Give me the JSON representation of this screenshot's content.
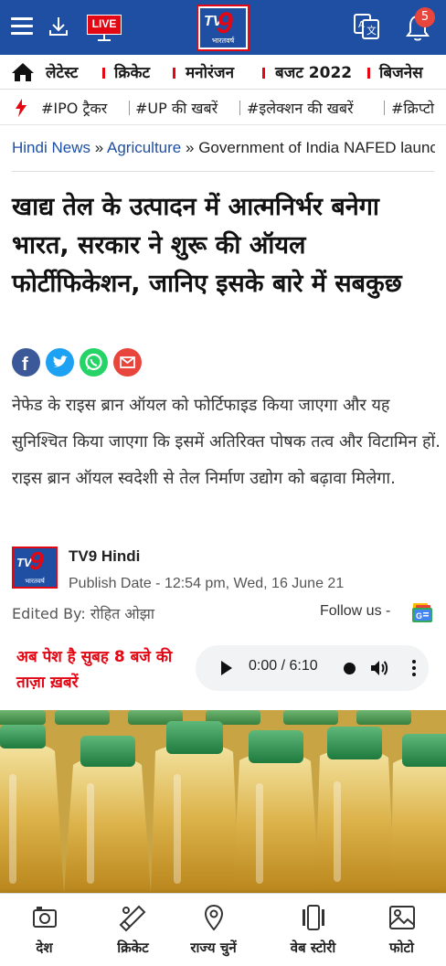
{
  "header": {
    "live_label": "LIVE",
    "logo_text": "TV9",
    "logo_sub": "भारतवर्ष",
    "notification_count": "5",
    "brand_color": "#1e4fa3",
    "accent_color": "#e30613"
  },
  "category_nav": {
    "items": [
      "लेटेस्ट",
      "क्रिकेट",
      "मनोरंजन",
      "बजट 2022",
      "बिजनेस"
    ]
  },
  "trending": {
    "items": [
      "#IPO ट्रैकर",
      "#UP की खबरें",
      "#इलेक्शन की खबरें",
      "#क्रिप्टो"
    ]
  },
  "breadcrumb": {
    "home": "Hindi News",
    "section": "Agriculture",
    "current": "Government of India NAFED launched rice bran oil fortification",
    "separator": "»"
  },
  "article": {
    "headline": "खाद्य तेल के उत्पादन में आत्मनिर्भर बनेगा भारत, सरकार ने शुरू की ऑयल फोर्टीफिकेशन, जानिए इसके बारे में सबकुछ",
    "summary": "नेफेड के राइस ब्रान ऑयल को फोर्टिफाइड किया जाएगा और यह सुनिश्चित किया जाएगा कि इसमें अतिरिक्त पोषक तत्व और विटामिन हों. राइस ब्रान ऑयल स्वदेशी से तेल निर्माण उद्योग को बढ़ावा मिलेगा.",
    "author": "TV9 Hindi",
    "publish_date": "Publish Date - 12:54 pm, Wed, 16 June 21",
    "edited_by": "Edited By: रोहित ओझा",
    "follow_us": "Follow us -"
  },
  "share": {
    "facebook_color": "#3b5998",
    "twitter_color": "#1da1f2",
    "whatsapp_color": "#25d366",
    "email_color": "#e8453c"
  },
  "audio": {
    "promo_text": "अब पेश है सुबह 8 बजे की ताज़ा ख़बरें",
    "time": "0:00 / 6:10"
  },
  "bottom_nav": {
    "items": [
      "देश",
      "क्रिकेट",
      "राज्य चुनें",
      "वेब स्टोरी",
      "फोटो"
    ]
  }
}
